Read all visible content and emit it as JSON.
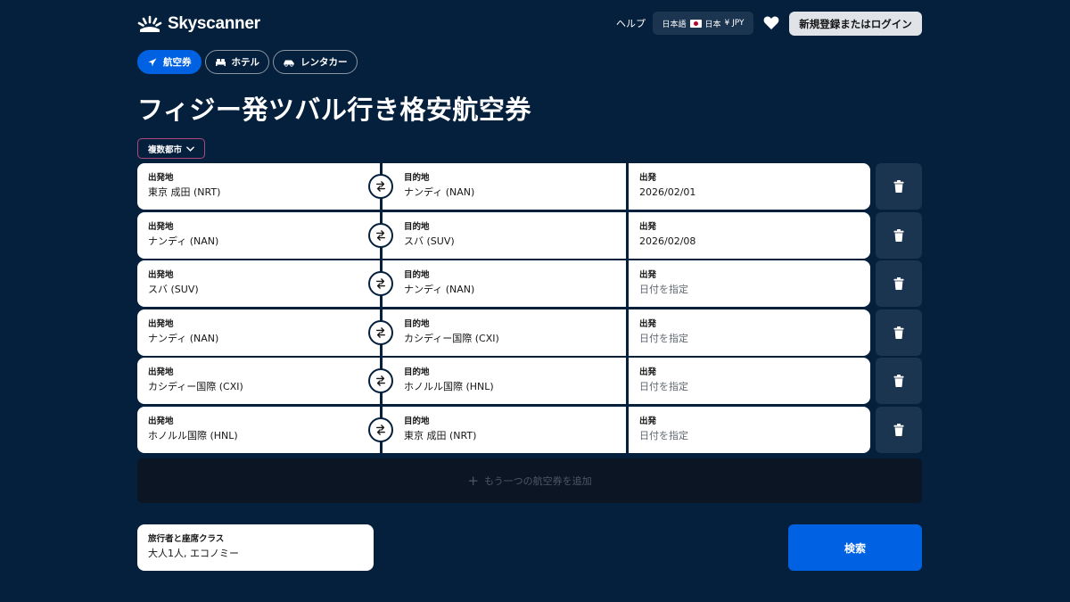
{
  "header": {
    "logo_text": "Skyscanner",
    "help_label": "ヘルプ",
    "locale": {
      "language": "日本語",
      "country": "日本",
      "currency": "¥ JPY"
    },
    "heart_icon": "heart-icon",
    "login_label": "新規登録またはログイン"
  },
  "tabs": [
    {
      "label": "航空券",
      "icon": "plane-icon",
      "active": true
    },
    {
      "label": "ホテル",
      "icon": "bed-icon",
      "active": false
    },
    {
      "label": "レンタカー",
      "icon": "car-icon",
      "active": false
    }
  ],
  "page_title": "フィジー発ツバル行き格安航空券",
  "trip_type": {
    "label": "複数都市",
    "icon": "chevron-down-icon"
  },
  "field_labels": {
    "origin": "出発地",
    "destination": "目的地",
    "date": "出発"
  },
  "legs": [
    {
      "origin": "東京 成田 (NRT)",
      "destination": "ナンディ (NAN)",
      "date": "2026/02/01",
      "date_is_placeholder": false
    },
    {
      "origin": "ナンディ (NAN)",
      "destination": "スバ (SUV)",
      "date": "2026/02/08",
      "date_is_placeholder": false
    },
    {
      "origin": "スバ (SUV)",
      "destination": "ナンディ (NAN)",
      "date": "日付を指定",
      "date_is_placeholder": true
    },
    {
      "origin": "ナンディ (NAN)",
      "destination": "カシディー国際 (CXI)",
      "date": "日付を指定",
      "date_is_placeholder": true
    },
    {
      "origin": "カシディー国際 (CXI)",
      "destination": "ホノルル国際 (HNL)",
      "date": "日付を指定",
      "date_is_placeholder": true
    },
    {
      "origin": "ホノルル国際 (HNL)",
      "destination": "東京 成田 (NRT)",
      "date": "日付を指定",
      "date_is_placeholder": true
    }
  ],
  "add_leg_label": "もう一つの航空券を追加",
  "travellers": {
    "label": "旅行者と座席クラス",
    "value": "大人1人, エコノミー"
  },
  "search_label": "検索",
  "colors": {
    "background": "#05203c",
    "accent_blue": "#0062e3",
    "panel_dark": "#1b3450",
    "trip_type_border": "#b1477d"
  }
}
